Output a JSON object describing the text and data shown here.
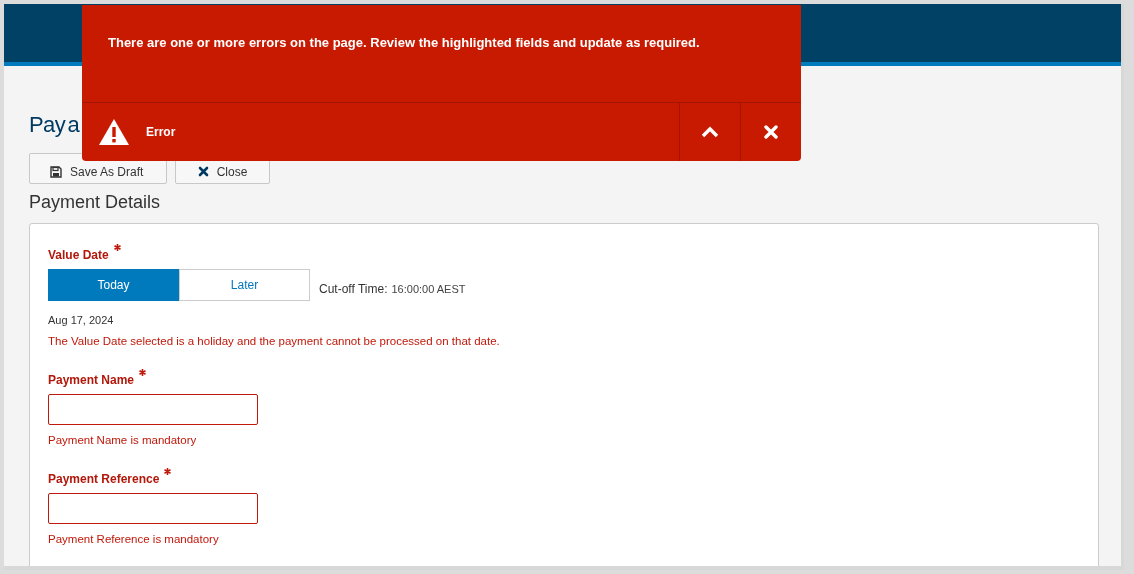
{
  "page": {
    "title": "Pay a"
  },
  "toolbar": [
    {
      "kind": "save",
      "label": "Save As Draft"
    },
    {
      "kind": "close",
      "label": "Close"
    }
  ],
  "section": {
    "title": "Payment Details"
  },
  "value_date": {
    "label": "Value Date",
    "required": true,
    "options": [
      {
        "label": "Today",
        "selected": true
      },
      {
        "label": "Later",
        "selected": false
      }
    ],
    "cutoff_label": "Cut-off Time:",
    "cutoff_value": "16:00:00 AEST",
    "date": "Aug 17, 2024",
    "error": "The Value Date selected is a holiday and the payment cannot be processed on that date."
  },
  "fields": [
    {
      "label": "Payment Name",
      "required": true,
      "error": "Payment Name is mandatory"
    },
    {
      "label": "Payment Reference",
      "required": true,
      "error": "Payment Reference is mandatory"
    }
  ],
  "toast": {
    "message": "There are one or more errors on the page. Review the highlighted fields and update as required.",
    "severity": "Error",
    "expanded": true
  }
}
